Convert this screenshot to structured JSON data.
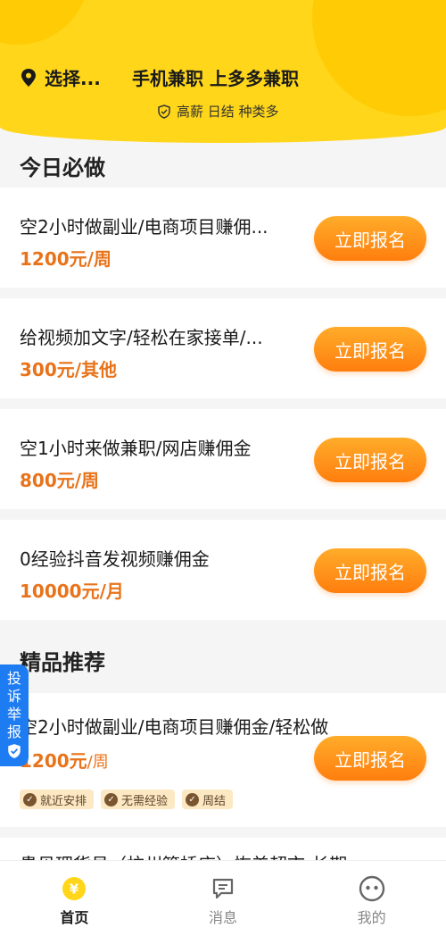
{
  "header": {
    "location": "选择...",
    "slogan": "手机兼职 上多多兼职",
    "tag": "高薪 日结 种类多",
    "colors": {
      "bg": "#ffd61a",
      "accent": "#ff8a1a",
      "salary": "#e8731a"
    }
  },
  "today": {
    "title": "今日必做",
    "items": [
      {
        "title": "空2小时做副业/电商项目赚佣...",
        "salary": "1200元/周",
        "button": "立即报名"
      },
      {
        "title": "给视频加文字/轻松在家接单/...",
        "salary": "300元/其他",
        "button": "立即报名"
      },
      {
        "title": "空1小时来做兼职/网店赚佣金",
        "salary": "800元/周",
        "button": "立即报名"
      },
      {
        "title": "0经验抖音发视频赚佣金",
        "salary": "10000元/月",
        "button": "立即报名"
      }
    ]
  },
  "featured": {
    "title": "精品推荐",
    "item": {
      "title": "空2小时做副业/电商项目赚佣金/轻松做",
      "salary_amount": "1200元",
      "salary_unit": "/周",
      "button": "立即报名",
      "pills": [
        "就近安排",
        "无需经验",
        "周结"
      ]
    },
    "partial_title": "贵贝理货员（杭州篮桥店）恢美超市-长期"
  },
  "report": {
    "chars": [
      "投",
      "诉",
      "举",
      "报"
    ]
  },
  "tabbar": {
    "tabs": [
      {
        "label": "首页",
        "icon": "yuan-coin-icon",
        "active": true
      },
      {
        "label": "消息",
        "icon": "message-icon",
        "active": false
      },
      {
        "label": "我的",
        "icon": "face-icon",
        "active": false
      }
    ]
  }
}
